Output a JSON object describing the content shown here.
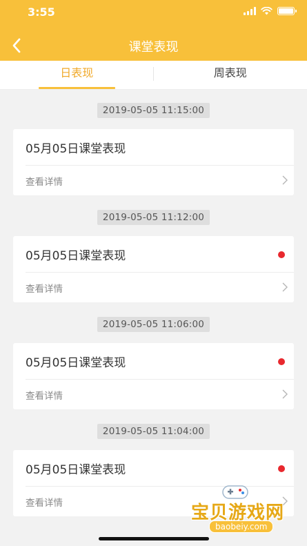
{
  "status_bar": {
    "time": "3:55"
  },
  "nav": {
    "title": "课堂表现"
  },
  "tabs": [
    {
      "label": "日表现",
      "active": true
    },
    {
      "label": "周表现",
      "active": false
    }
  ],
  "entries": [
    {
      "timestamp": "2019-05-05 11:15:00",
      "title": "05月05日课堂表现",
      "detail_label": "查看详情",
      "unread": false
    },
    {
      "timestamp": "2019-05-05 11:12:00",
      "title": "05月05日课堂表现",
      "detail_label": "查看详情",
      "unread": true
    },
    {
      "timestamp": "2019-05-05 11:06:00",
      "title": "05月05日课堂表现",
      "detail_label": "查看详情",
      "unread": true
    },
    {
      "timestamp": "2019-05-05 11:04:00",
      "title": "05月05日课堂表现",
      "detail_label": "查看详情",
      "unread": true
    }
  ],
  "watermark": {
    "text": "宝贝游戏网",
    "url": "baobeiy.com"
  },
  "colors": {
    "header": "#f8c03a",
    "active_tab": "#f0a92a",
    "unread_dot": "#e8282e",
    "background": "#f2f2f2"
  },
  "icons": {
    "back": "chevron-left-icon",
    "detail": "chevron-right-icon",
    "wifi": "wifi-icon",
    "battery": "battery-icon",
    "signal": "signal-icon"
  }
}
